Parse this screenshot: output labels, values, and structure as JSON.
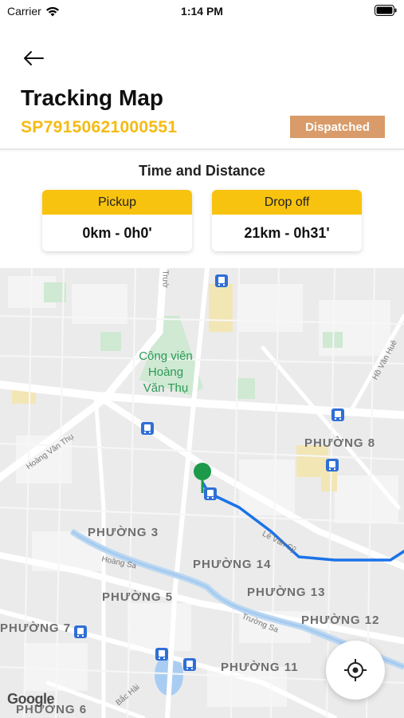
{
  "status_bar": {
    "carrier": "Carrier",
    "time": "1:14 PM"
  },
  "header": {
    "title": "Tracking Map",
    "tracking_id": "SP79150621000551",
    "status": "Dispatched",
    "status_color": "#d89b69",
    "accent_color": "#f5bb14"
  },
  "time_distance": {
    "title": "Time and Distance",
    "pickup": {
      "label": "Pickup",
      "value": "0km - 0h0'"
    },
    "dropoff": {
      "label": "Drop off",
      "value": "21km - 0h31'"
    }
  },
  "map": {
    "park_name": "Công viên Hoàng Văn Thụ",
    "park_lines": [
      "Công viên",
      "Hoàng",
      "Văn Thụ"
    ],
    "districts": [
      "PHƯỜNG 8",
      "PHƯỜNG 3",
      "PHƯỜNG 14",
      "PHƯỜNG 5",
      "PHƯỜNG 13",
      "PHƯỜNG 12",
      "PHƯỜNG 7",
      "PHƯỜNG 11",
      "PHƯỜNG 6"
    ],
    "streets": [
      "Hoàng Văn Thụ",
      "Hoàng Sa",
      "Lê Văn Sỹ",
      "Trường Sa",
      "Hồ Văn Huê",
      "Bắc Hải",
      "Trườ"
    ],
    "route_color": "#1a73e8",
    "marker_color": "#1c9a4a",
    "attribution": "Google"
  }
}
